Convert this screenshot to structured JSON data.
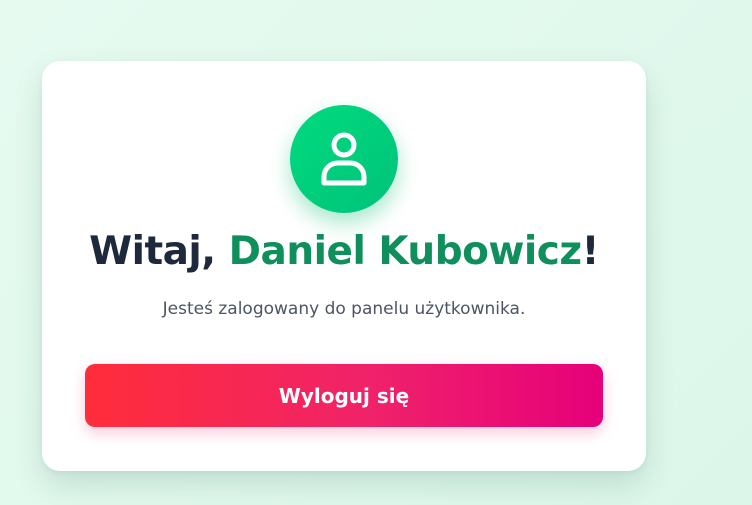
{
  "card": {
    "greeting_prefix": "Witaj, ",
    "user_name": "Daniel Kubowicz",
    "greeting_suffix": "!",
    "subtitle": "Jesteś zalogowany do panelu użytkownika.",
    "logout_label": "Wyloguj się",
    "avatar_icon": "user-icon"
  },
  "colors": {
    "background": "#dff8ec",
    "avatar_gradient_start": "#00db7e",
    "avatar_gradient_end": "#00c27a",
    "name_accent": "#0f8f5b",
    "heading_text": "#1e293b",
    "logout_gradient_start": "#ff2d3a",
    "logout_gradient_end": "#e6007a"
  }
}
